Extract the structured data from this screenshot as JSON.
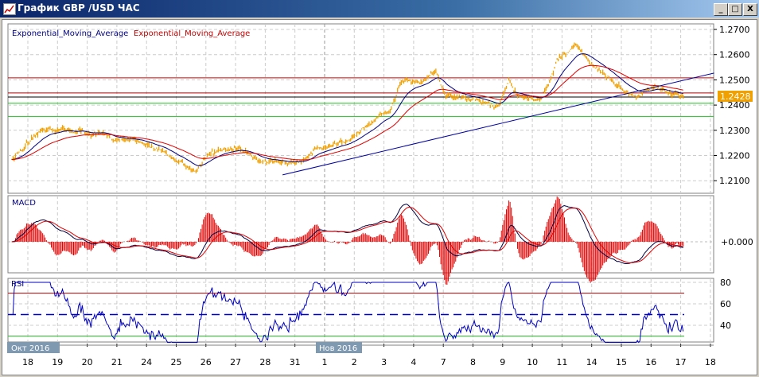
{
  "window": {
    "title": "График GBP /USD  ЧАС",
    "buttons": {
      "minimize": "_",
      "maximize": "□",
      "close": "X"
    }
  },
  "price_pane": {
    "legend": [
      "Exponential_Moving_Average",
      "Exponential_Moving_Average"
    ],
    "current_price": "1.2428"
  },
  "macd_pane": {
    "label": "MACD",
    "zero_label": "+0.000"
  },
  "rsi_pane": {
    "label": "RSI"
  },
  "month_tags": [
    "Окт 2016",
    "Нов 2016"
  ],
  "colors": {
    "price": "#f0a000",
    "ema_fast": "#000080",
    "ema_slow": "#e00000",
    "level_red": "#d00000",
    "level_green": "#20c020",
    "trend": "#0000a0",
    "rsi": "#0000c0",
    "tag": "#f0a000"
  },
  "chart_data": [
    {
      "type": "line",
      "pane": "price",
      "ylim": [
        1.207,
        1.272
      ],
      "yticks": [
        "1.2700",
        "1.2600",
        "1.2500",
        "1.2400",
        "1.2300",
        "1.2200",
        "1.2100"
      ],
      "ytick_values": [
        1.27,
        1.26,
        1.25,
        1.24,
        1.23,
        1.22,
        1.21
      ],
      "grid": true,
      "xtick_labels": [
        "18",
        "19",
        "20",
        "21",
        "24",
        "25",
        "26",
        "27",
        "28",
        "31",
        "1",
        "2",
        "3",
        "4",
        "7",
        "8",
        "9",
        "10",
        "11",
        "14",
        "15",
        "16",
        "17",
        "18"
      ],
      "trading_dates": [
        "10-18",
        "10-19",
        "10-20",
        "10-21",
        "10-24",
        "10-25",
        "10-26",
        "10-27",
        "10-28",
        "10-31",
        "11-01",
        "11-02",
        "11-03",
        "11-04",
        "11-07",
        "11-08",
        "11-09",
        "11-10",
        "11-11",
        "11-14",
        "11-15",
        "11-16",
        "11-17",
        "11-18"
      ],
      "price_keypoints": [
        [
          "10-17 11:00",
          1.2186
        ],
        [
          "10-18 16:00",
          1.231
        ],
        [
          "10-20 00:00",
          1.229
        ],
        [
          "10-21 02:00",
          1.2265
        ],
        [
          "10-24 10:00",
          1.223
        ],
        [
          "10-25 15:00",
          1.214
        ],
        [
          "10-26 01:00",
          1.22
        ],
        [
          "10-27 02:00",
          1.223
        ],
        [
          "10-27 22:00",
          1.2185
        ],
        [
          "10-28 14:00",
          1.2155
        ],
        [
          "10-31 06:00",
          1.22
        ],
        [
          "10-31 19:00",
          1.223
        ],
        [
          "11-01 21:00",
          1.2265
        ],
        [
          "11-02 16:00",
          1.233
        ],
        [
          "11-03 05:00",
          1.2375
        ],
        [
          "11-03 14:00",
          1.2485
        ],
        [
          "11-04 06:00",
          1.25
        ],
        [
          "11-04 18:00",
          1.254
        ],
        [
          "11-07 02:00",
          1.2438
        ],
        [
          "11-08 04:00",
          1.242
        ],
        [
          "11-08 20:00",
          1.239
        ],
        [
          "11-09 05:00",
          1.25
        ],
        [
          "11-09 12:00",
          1.2438
        ],
        [
          "11-10 07:00",
          1.242
        ],
        [
          "11-10 20:00",
          1.258
        ],
        [
          "11-11 12:00",
          1.2643
        ],
        [
          "11-11 22:00",
          1.258
        ],
        [
          "11-14 11:00",
          1.2517
        ],
        [
          "11-14 23:00",
          1.247
        ],
        [
          "11-15 12:00",
          1.242
        ],
        [
          "11-16 01:00",
          1.247
        ],
        [
          "11-16 17:00",
          1.2445
        ],
        [
          "11-17 03:00",
          1.2428
        ]
      ],
      "series": [
        {
          "name": "Exponential_Moving_Average",
          "color": "#000080"
        },
        {
          "name": "Exponential_Moving_Average",
          "color": "#e00000"
        }
      ],
      "levels": [
        {
          "value": 1.2508,
          "color": "#d00000"
        },
        {
          "value": 1.2448,
          "color": "#b00000"
        },
        {
          "value": 1.2432,
          "color": "#000000"
        },
        {
          "value": 1.2407,
          "color": "#20c020"
        },
        {
          "value": 1.2355,
          "color": "#20c020"
        }
      ],
      "trendline": [
        [
          "10-28 14:00",
          1.2123
        ],
        [
          "11-18 03:00",
          1.2527
        ]
      ]
    },
    {
      "type": "line+bar",
      "pane": "macd",
      "zero": 0,
      "series": [
        "MACD",
        "signal",
        "histogram"
      ]
    },
    {
      "type": "line",
      "pane": "rsi",
      "ylim": [
        22,
        82
      ],
      "yticks": [
        "80",
        "60",
        "40"
      ],
      "ytick_values": [
        80,
        60,
        40
      ],
      "levels": [
        70,
        50,
        30
      ]
    }
  ]
}
